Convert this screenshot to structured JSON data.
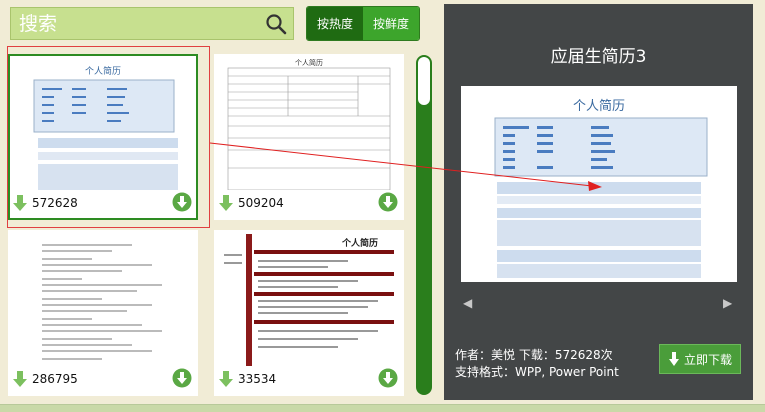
{
  "search": {
    "placeholder": "搜索"
  },
  "sort": {
    "hot_label": "按热度",
    "fresh_label": "按鲜度"
  },
  "resumes": [
    {
      "count": "572628"
    },
    {
      "count": "509204"
    },
    {
      "count": "286795"
    },
    {
      "count": "33534"
    }
  ],
  "thumb_text": {
    "resume_title": "个人简历"
  },
  "preview": {
    "title": "应届生简历3",
    "doc_heading": "个人简历",
    "prev": "◀",
    "next": "▶",
    "author_line": "作者：美悦 下载：572628次",
    "format_line": "支持格式：WPP, Power Point",
    "download_label": "立即下载"
  },
  "colors": {
    "accent_green": "#3da52c",
    "panel_dark": "#434647",
    "highlight_red": "#e04040"
  },
  "icons": {
    "search": "search-icon",
    "download": "download-icon",
    "arrow": "arrow-down-icon"
  }
}
